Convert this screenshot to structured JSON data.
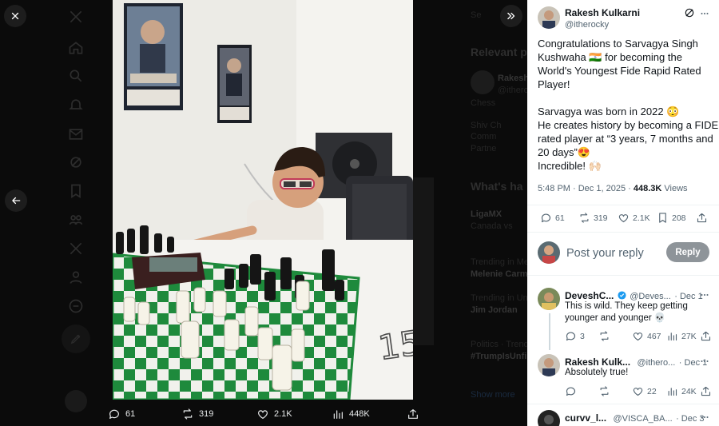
{
  "post": {
    "author_name": "Rakesh Kulkarni",
    "author_handle": "@itherocky",
    "text_lines": [
      "Congratulations to Sarvagya Singh",
      "Kushwaha 🇮🇳 for becoming the",
      "World's Youngest Fide Rapid Rated",
      "Player!",
      "",
      "Sarvagya was born in 2022 😳",
      "He creates history by becoming a FIDE",
      "rated player at “3 years, 7 months and",
      "20 days”😍",
      "Incredible! 🙌🏻"
    ],
    "time": "5:48 PM · Dec 1, 2025 ·",
    "views_count": "448.3K",
    "views_label": "Views",
    "stats": {
      "replies": "61",
      "reposts": "319",
      "likes": "2.1K",
      "bookmarks": "208"
    }
  },
  "media_bar": {
    "replies": "61",
    "reposts": "319",
    "likes": "2.1K",
    "views": "448K"
  },
  "reply_box": {
    "placeholder": "Post your reply",
    "button": "Reply"
  },
  "replies": [
    {
      "name": "DeveshC...",
      "handle": "@Deves...",
      "date": "· Dec 1",
      "verified": true,
      "text_lines": [
        "This is wild. They keep getting",
        "younger and younger 💀"
      ],
      "replies": "3",
      "reposts": "",
      "likes": "467",
      "views": "27K"
    },
    {
      "name": "Rakesh Kulk...",
      "handle": "@ithero...",
      "date": "· Dec 1",
      "verified": false,
      "text_lines": [
        "Absolutely true!"
      ],
      "replies": "",
      "reposts": "",
      "likes": "22",
      "views": "24K"
    },
    {
      "name": "curvv_l...",
      "handle": "@VISCA_BA...",
      "date": "· Dec 3"
    }
  ],
  "background": {
    "relevant_header": "Relevant p",
    "whats_header": "What's ha",
    "items": [
      "Rakesh",
      "@ithero",
      "Chess",
      "Shiv Ch",
      "Comm",
      "Partne",
      "LigaMX",
      "Canada vs",
      "Trending in Mexi",
      "Melenie Carm",
      "Trending in Unite",
      "Jim Jordan",
      "Politics · Trendi",
      "#TrumpIsUnfi",
      "Show more"
    ]
  },
  "photo": {
    "chalk_number": "15"
  },
  "icons": {
    "close": "close-icon",
    "collapse": "double-chevron-right-icon",
    "back": "arrow-left-icon",
    "grok": "grok-icon",
    "more": "more-icon",
    "reply": "reply-icon",
    "repost": "repost-icon",
    "like": "heart-icon",
    "bookmark": "bookmark-icon",
    "share": "share-icon",
    "views": "views-icon"
  },
  "colors": {
    "accent": "#1d9bf0",
    "reply_button": "#8e9499",
    "text": "#0f1419",
    "muted": "#536471"
  }
}
